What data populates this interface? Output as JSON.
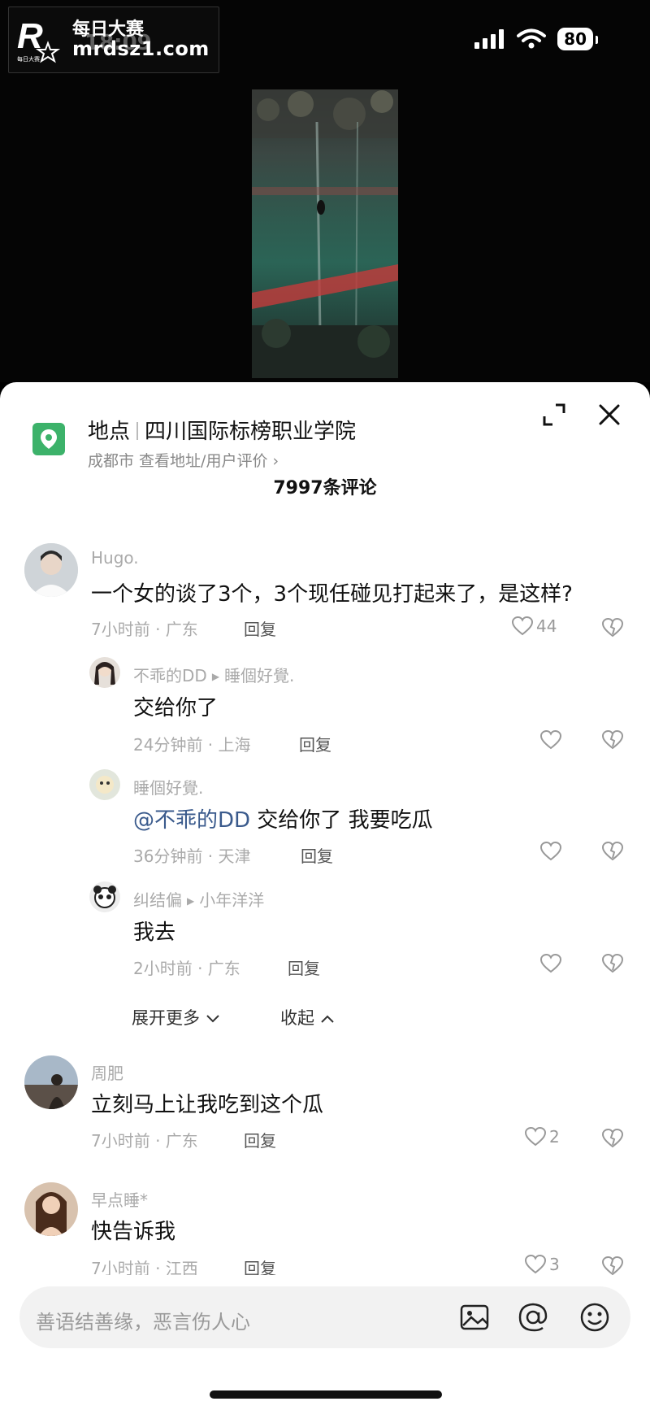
{
  "watermark": {
    "brand_cn": "每日大赛",
    "url": "mrdsz1.com",
    "logo_text": "R"
  },
  "status": {
    "time": "18:09",
    "battery": "80"
  },
  "location": {
    "label": "地点",
    "name": "四川国际标榜职业学院",
    "sub": "成都市 查看地址/用户评价 ›"
  },
  "comments_header": "7997条评论",
  "comments": [
    {
      "user": "Hugo.",
      "text": "一个女的谈了3个，3个现任碰见打起来了，是这样?",
      "meta": "7小时前 · 广东",
      "reply": "回复",
      "likes": "44"
    },
    {
      "user": "不乖的DD",
      "reply_to": "睡個好覺.",
      "text": "交给你了",
      "meta": "24分钟前 · 上海",
      "reply": "回复",
      "likes": ""
    },
    {
      "user": "睡個好覺.",
      "mention": "@不乖的DD",
      "text": " 交给你了 我要吃瓜",
      "meta": "36分钟前 · 天津",
      "reply": "回复",
      "likes": ""
    },
    {
      "user": "纠结偏",
      "reply_to": "小年洋洋",
      "text": "我去",
      "meta": "2小时前 · 广东",
      "reply": "回复",
      "likes": ""
    },
    {
      "user": "周肥",
      "text": "立刻马上让我吃到这个瓜",
      "meta": "7小时前 · 广东",
      "reply": "回复",
      "likes": "2"
    },
    {
      "user": "早点睡*",
      "text": "快告诉我",
      "meta": "7小时前 · 江西",
      "reply": "回复",
      "likes": "3"
    }
  ],
  "thread_controls": {
    "expand_more": "展开更多",
    "collapse": "收起"
  },
  "input": {
    "placeholder": "善语结善缘，恶言伤人心"
  },
  "colors": {
    "location_green": "#3cb26a",
    "mention_blue": "#3a5a8c"
  }
}
